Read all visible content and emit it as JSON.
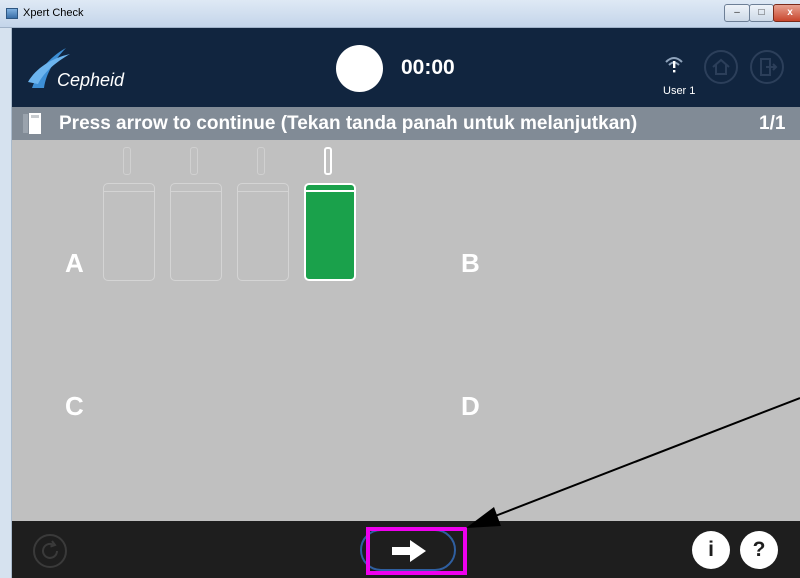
{
  "window": {
    "title": "Xpert Check",
    "minimize_label": "–",
    "maximize_label": "□",
    "close_label": "x"
  },
  "header": {
    "logo_text": "Cepheid",
    "timer": "00:00",
    "user_label": "User 1"
  },
  "instruction": {
    "text": "Press arrow to continue (Tekan tanda panah untuk melanjutkan)",
    "page": "1/1"
  },
  "modules": {
    "quadrants": [
      "A",
      "B",
      "C",
      "D"
    ],
    "active_module_index": 4
  },
  "footer": {
    "info_label": "i",
    "help_label": "?"
  },
  "colors": {
    "header_bg": "#11253f",
    "instruction_bg": "#818b96",
    "content_bg": "#c0c0c0",
    "active_module": "#1aa14b",
    "highlight": "#ee00ee",
    "footer_bg": "#1e1e1e"
  },
  "icons": {
    "logo": "cepheid-swoosh-icon",
    "user": "signal-user-icon",
    "home": "home-icon",
    "logout": "logout-icon",
    "instruction": "document-icon",
    "reset": "refresh-icon",
    "next": "arrow-right-icon",
    "info": "info-icon",
    "help": "help-icon"
  }
}
